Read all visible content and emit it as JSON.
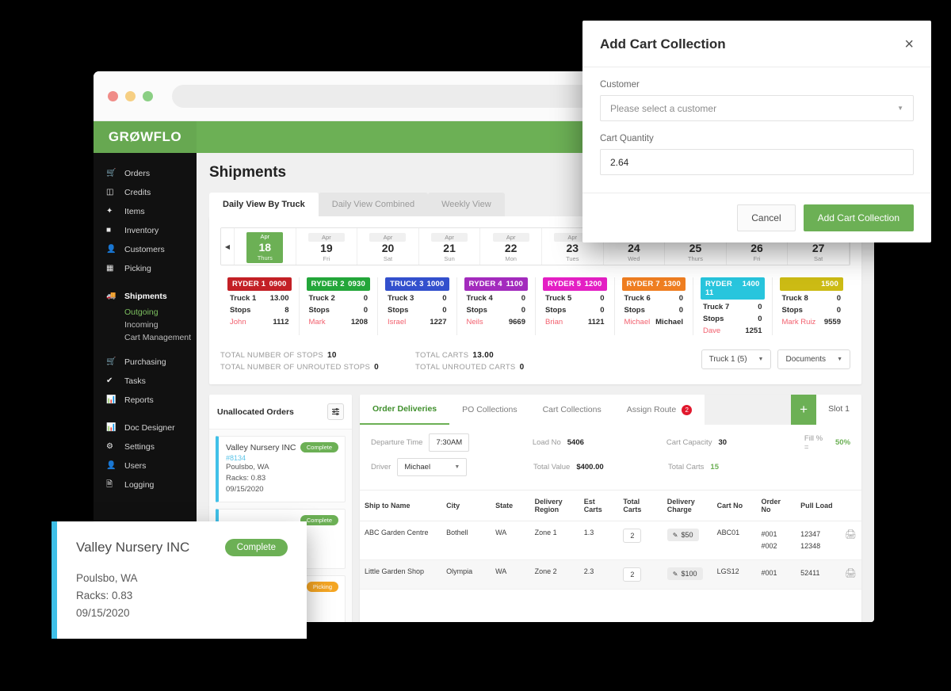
{
  "brand": "GRØWFLO",
  "page_title": "Shipments",
  "sidebar": {
    "items": [
      {
        "label": "Orders",
        "icon": "cart-icon"
      },
      {
        "label": "Credits",
        "icon": "list-icon"
      },
      {
        "label": "Items",
        "icon": "leaf-icon"
      },
      {
        "label": "Inventory",
        "icon": "bars-icon"
      },
      {
        "label": "Customers",
        "icon": "user-icon"
      },
      {
        "label": "Picking",
        "icon": "clipboard-icon"
      }
    ],
    "shipments": {
      "label": "Shipments",
      "icon": "truck-icon"
    },
    "shipments_sub": [
      {
        "label": "Outgoing",
        "active": true
      },
      {
        "label": "Incoming",
        "active": false
      },
      {
        "label": "Cart Management",
        "active": false
      }
    ],
    "items2": [
      {
        "label": "Purchasing",
        "icon": "cart-icon"
      },
      {
        "label": "Tasks",
        "icon": "check-circle-icon"
      },
      {
        "label": "Reports",
        "icon": "chart-icon"
      }
    ],
    "items3": [
      {
        "label": "Doc Designer",
        "icon": "chart-icon"
      },
      {
        "label": "Settings",
        "icon": "gear-icon"
      },
      {
        "label": "Users",
        "icon": "user-icon"
      },
      {
        "label": "Logging",
        "icon": "file-icon"
      }
    ]
  },
  "view_tabs": [
    {
      "label": "Daily View By Truck",
      "active": true
    },
    {
      "label": "Daily View Combined",
      "active": false
    },
    {
      "label": "Weekly View",
      "active": false
    }
  ],
  "dates": [
    {
      "month": "Apr",
      "day": "18",
      "weekday": "Thurs",
      "selected": true
    },
    {
      "month": "Apr",
      "day": "19",
      "weekday": "Fri",
      "selected": false
    },
    {
      "month": "Apr",
      "day": "20",
      "weekday": "Sat",
      "selected": false
    },
    {
      "month": "Apr",
      "day": "21",
      "weekday": "Sun",
      "selected": false
    },
    {
      "month": "Apr",
      "day": "22",
      "weekday": "Mon",
      "selected": false
    },
    {
      "month": "Apr",
      "day": "23",
      "weekday": "Tues",
      "selected": false
    },
    {
      "month": "Apr",
      "day": "24",
      "weekday": "Wed",
      "selected": false
    },
    {
      "month": "Apr",
      "day": "25",
      "weekday": "Thurs",
      "selected": false
    },
    {
      "month": "Apr",
      "day": "26",
      "weekday": "Fri",
      "selected": false
    },
    {
      "month": "Apr",
      "day": "27",
      "weekday": "Sat",
      "selected": false
    }
  ],
  "trucks": [
    {
      "header": "RYDER 1",
      "time": "0900",
      "color": "#c32026",
      "truck_label": "Truck 1",
      "truck_value": "13.00",
      "stops_label": "Stops",
      "stops_value": "8",
      "driver": "John",
      "driver_value": "1112"
    },
    {
      "header": "RYDER 2",
      "time": "0930",
      "color": "#23a63a",
      "truck_label": "Truck 2",
      "truck_value": "0",
      "stops_label": "Stops",
      "stops_value": "0",
      "driver": "Mark",
      "driver_value": "1208"
    },
    {
      "header": "TRUCK 3",
      "time": "1000",
      "color": "#3350cd",
      "truck_label": "Truck 3",
      "truck_value": "0",
      "stops_label": "Stops",
      "stops_value": "0",
      "driver": "Israel",
      "driver_value": "1227"
    },
    {
      "header": "RYDER 4",
      "time": "1100",
      "color": "#a32bbd",
      "truck_label": "Truck 4",
      "truck_value": "0",
      "stops_label": "Stops",
      "stops_value": "0",
      "driver": "Neils",
      "driver_value": "9669"
    },
    {
      "header": "RYDER 5",
      "time": "1200",
      "color": "#e41fc4",
      "truck_label": "Truck 5",
      "truck_value": "0",
      "stops_label": "Stops",
      "stops_value": "0",
      "driver": "Brian",
      "driver_value": "1121"
    },
    {
      "header": "RYDER 7",
      "time": "1300",
      "color": "#ef7e21",
      "truck_label": "Truck 6",
      "truck_value": "0",
      "stops_label": "Stops",
      "stops_value": "0",
      "driver": "Michael",
      "driver_value": "Michael"
    },
    {
      "header": "RYDER 11",
      "time": "1400",
      "color": "#28c5dd",
      "truck_label": "Truck 7",
      "truck_value": "0",
      "stops_label": "Stops",
      "stops_value": "0",
      "driver": "Dave",
      "driver_value": "1251"
    },
    {
      "header": "",
      "time": "1500",
      "color": "#ccbb14",
      "truck_label": "Truck 8",
      "truck_value": "0",
      "stops_label": "Stops",
      "stops_value": "0",
      "driver": "Mark Ruiz",
      "driver_value": "9559"
    }
  ],
  "totals": {
    "stops_label": "TOTAL NUMBER OF STOPS",
    "stops_value": "10",
    "unrouted_stops_label": "TOTAL NUMBER OF UNROUTED STOPS",
    "unrouted_stops_value": "0",
    "carts_label": "TOTAL CARTS",
    "carts_value": "13.00",
    "unrouted_carts_label": "TOTAL UNROUTED CARTS",
    "unrouted_carts_value": "0",
    "truck_select": "Truck 1 (5)",
    "documents_select": "Documents"
  },
  "unallocated": {
    "title": "Unallocated Orders",
    "orders": [
      {
        "name": "Valley Nursery INC",
        "number": "#8134",
        "location": "Poulsbo, WA",
        "racks": "Racks: 0.83",
        "date": "09/15/2020",
        "status": "Complete"
      },
      {
        "name": "",
        "number": "",
        "location": "",
        "racks": "",
        "date": "",
        "status": "Complete"
      },
      {
        "name": "",
        "number": "",
        "location": "",
        "racks": "",
        "date": "",
        "status": "Picking"
      }
    ]
  },
  "deliveries": {
    "tabs": [
      {
        "label": "Order Deliveries",
        "active": true,
        "badge": ""
      },
      {
        "label": "PO Collections",
        "active": false,
        "badge": ""
      },
      {
        "label": "Cart Collections",
        "active": false,
        "badge": ""
      },
      {
        "label": "Assign Route",
        "active": false,
        "badge": "2"
      }
    ],
    "slot_label": "Slot 1",
    "add_label": "+",
    "fields": {
      "departure_time_label": "Departure Time",
      "departure_time_value": "7:30AM",
      "driver_label": "Driver",
      "driver_value": "Michael",
      "load_no_label": "Load No",
      "load_no_value": "5406",
      "total_value_label": "Total Value",
      "total_value_value": "$400.00",
      "cart_capacity_label": "Cart Capacity",
      "cart_capacity_value": "30",
      "total_carts_label": "Total Carts",
      "total_carts_value": "15",
      "fill_label": "Fill % =",
      "fill_value": "50%"
    },
    "columns": [
      "Ship to Name",
      "City",
      "State",
      "Delivery Region",
      "Est Carts",
      "Total Carts",
      "Delivery Charge",
      "Cart No",
      "Order No",
      "Pull Load",
      ""
    ],
    "rows": [
      {
        "ship_to": "ABC Garden Centre",
        "city": "Bothell",
        "state": "WA",
        "region": "Zone 1",
        "est_carts": "1.3",
        "total_carts": "2",
        "charge": "$50",
        "cart_no": "ABC01",
        "order_no": [
          "#001",
          "#002"
        ],
        "pull_load": [
          "12347",
          "12348"
        ],
        "print": "print-icon"
      },
      {
        "ship_to": "Little Garden Shop",
        "city": "Olympia",
        "state": "WA",
        "region": "Zone 2",
        "est_carts": "2.3",
        "total_carts": "2",
        "charge": "$100",
        "cart_no": "LGS12",
        "order_no": [
          "#001"
        ],
        "pull_load": [
          "52411"
        ],
        "print": "print-icon"
      }
    ]
  },
  "float_card": {
    "name": "Valley Nursery INC",
    "status": "Complete",
    "location": "Poulsbo, WA",
    "racks": "Racks: 0.83",
    "date": "09/15/2020"
  },
  "modal": {
    "title": "Add Cart Collection",
    "close": "×",
    "customer_label": "Customer",
    "customer_placeholder": "Please select a customer",
    "quantity_label": "Cart Quantity",
    "quantity_value": "2.64",
    "cancel_label": "Cancel",
    "submit_label": "Add Cart Collection"
  },
  "colors": {
    "brand_green": "#6cb055",
    "accent_blue": "#3fc0e8",
    "danger_red": "#e1182d",
    "picking_orange": "#f5a623"
  }
}
